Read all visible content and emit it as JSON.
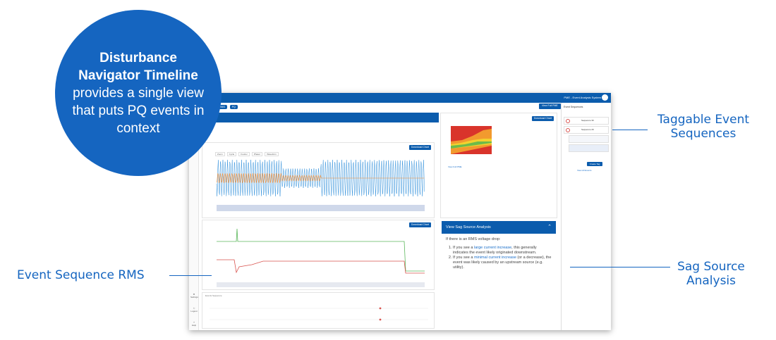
{
  "bubble": {
    "title": "Disturbance Navigator Timeline",
    "body": "provides a single view that puts PQ events in context"
  },
  "callouts": {
    "taggable": "Taggable Event Sequences",
    "rms": "Event Sequence RMS",
    "sag": "Sag Source Analysis"
  },
  "app": {
    "topbar_right": "PME - Event Analysis System",
    "nav_tabs": [
      "RMS",
      "PQ"
    ],
    "view_button": "View Full PME",
    "download_chart": "Download Chart",
    "waveform_tabs": [
      "Zoom",
      "Cycle",
      "Fourier",
      "Phasor",
      "Waveform"
    ],
    "left_nav": [
      "Settings",
      "Logout",
      "Help"
    ],
    "events_sequence_label": "Events Sequence",
    "view_full_pme_link": "View Full PME",
    "colors": {
      "primary": "#0b5cad",
      "voltage": "#2f8fdb",
      "current": "#f28a2e",
      "green": "#5cb85c",
      "red": "#d9534f"
    }
  },
  "sag_panel": {
    "header": "View Sag Source Analysis",
    "intro": "If there is an RMS voltage drop:",
    "item1_pre": "If you see a ",
    "item1_link": "large current increase",
    "item1_post": ", this generally indicates the event likely originated downstream.",
    "item2_pre": "If you see a ",
    "item2_link": "minimal current increase",
    "item2_post": " (or a decrease), the event was likely caused by an upstream source (e.g. utility)."
  },
  "sidebar": {
    "title": "Event Sequences",
    "sequences": [
      "Sequence 30",
      "Sequence 29"
    ],
    "create_tag": "Create Tag",
    "view_all": "View All Events"
  }
}
